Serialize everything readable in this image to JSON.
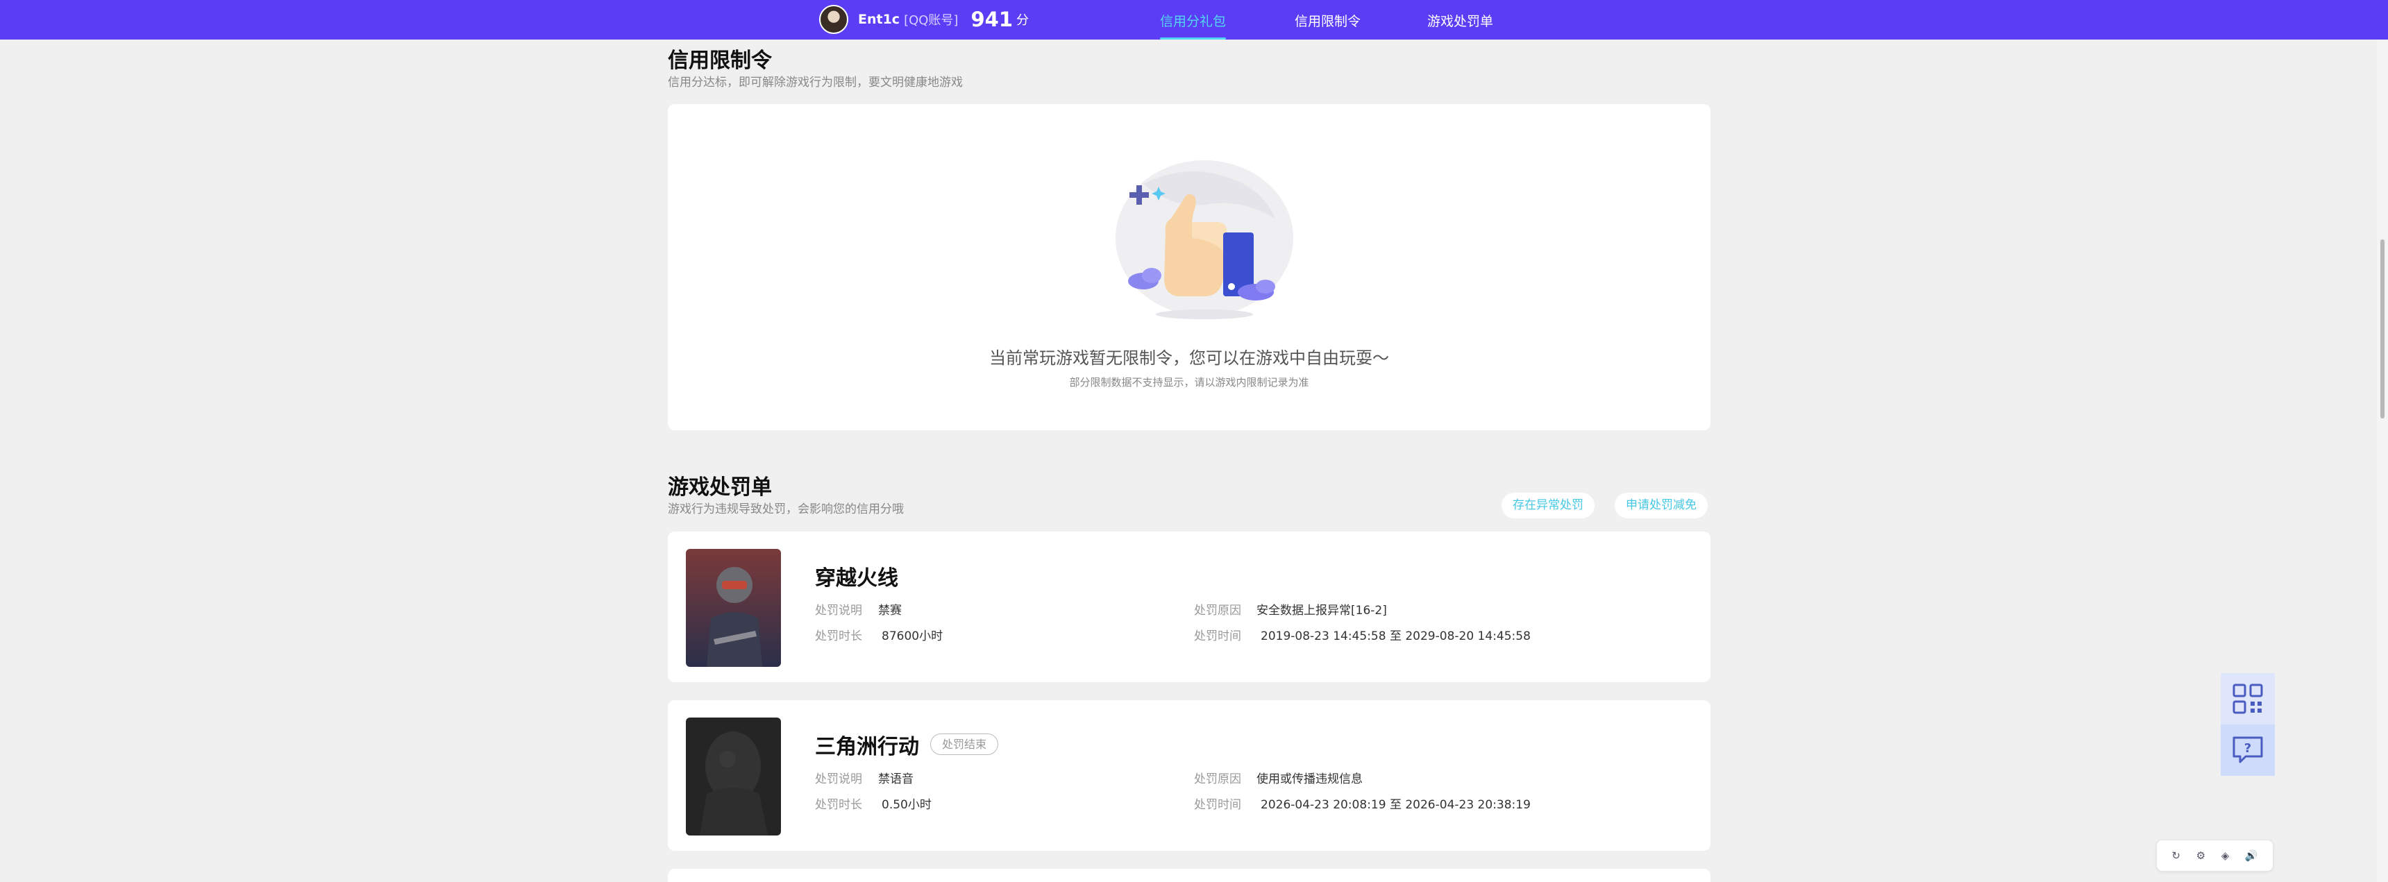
{
  "topbar": {
    "username": "Ent1c",
    "account_type": "[QQ账号]",
    "score": "941",
    "score_unit": "分",
    "tabs": [
      "信用分礼包",
      "信用限制令",
      "游戏处罚单"
    ]
  },
  "restriction": {
    "title": "信用限制令",
    "subtitle": "信用分达标，即可解除游戏行为限制，要文明健康地游戏",
    "empty_main": "当前常玩游戏暂无限制令，您可以在游戏中自由玩耍～",
    "empty_sub": "部分限制数据不支持显示，请以游戏内限制记录为准"
  },
  "penalty": {
    "title": "游戏处罚单",
    "subtitle": "游戏行为违规导致处罚，会影响您的信用分哦",
    "btn_anomaly": "存在异常处罚",
    "btn_reduce": "申请处罚减免",
    "labels": {
      "desc": "处罚说明",
      "duration": "处罚时长",
      "reason": "处罚原因",
      "time": "处罚时间"
    },
    "items": [
      {
        "game": "穿越火线",
        "badge": "",
        "desc": "禁赛",
        "duration": "87600小时",
        "reason": "安全数据上报异常[16-2]",
        "time": "2019-08-23 14:45:58 至 2029-08-20 14:45:58"
      },
      {
        "game": "三角洲行动",
        "badge": "处罚结束",
        "desc": "禁语音",
        "duration": "0.50小时",
        "reason": "使用或传播违规信息",
        "time": "2026-04-23 20:08:19 至 2026-04-23 20:38:19"
      }
    ]
  },
  "side": {
    "icons": [
      "qrcode-icon",
      "help-chat-icon"
    ]
  },
  "mini_toolbar": {
    "icons": [
      "refresh-icon",
      "settings-icon",
      "browser-icon",
      "speaker-icon"
    ],
    "glyphs": [
      "↻",
      "⚙",
      "◈",
      "🔊"
    ]
  },
  "colors": {
    "topbar": "#5b3df5",
    "accent": "#52d8f2",
    "pill_text": "#45c7e6",
    "background": "#f0f0f0"
  }
}
